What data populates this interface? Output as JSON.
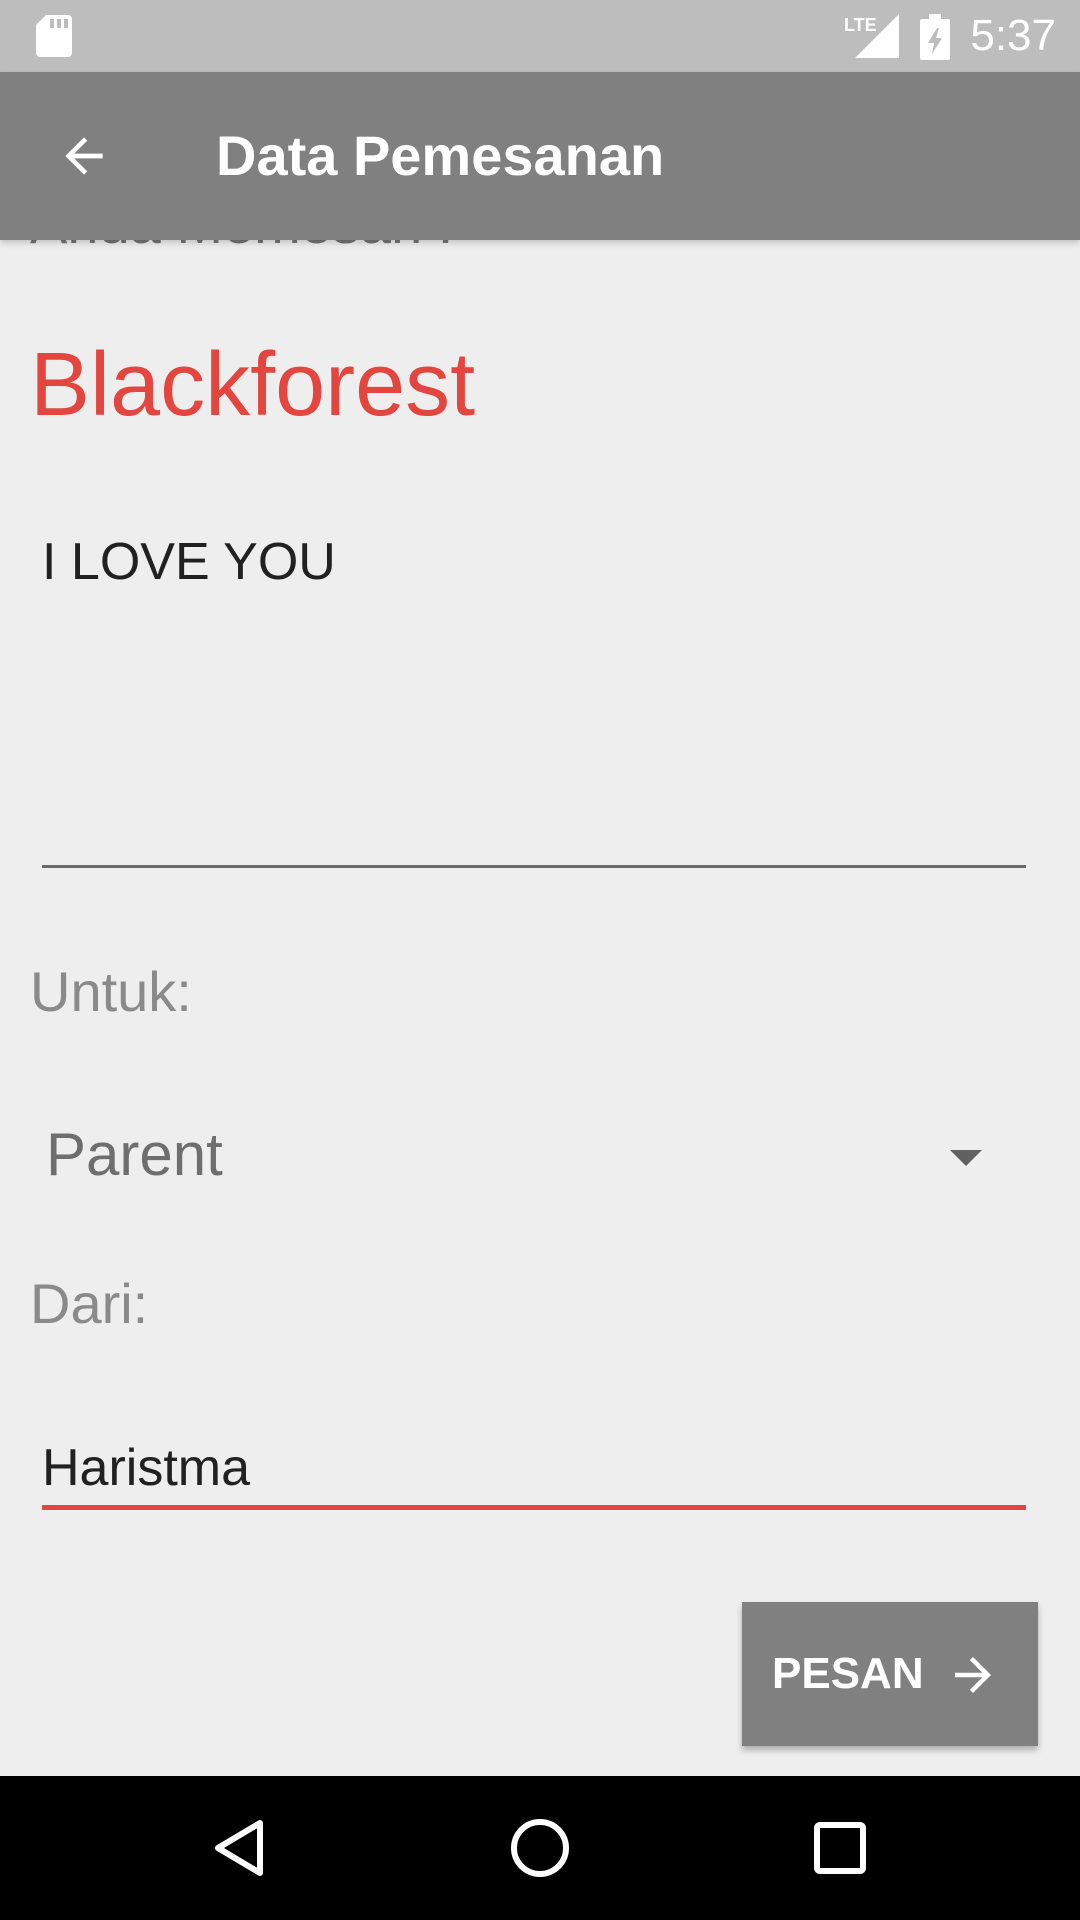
{
  "status_bar": {
    "time": "5:37",
    "network_label": "LTE",
    "icons": [
      "sd-card-icon",
      "lte-signal-icon",
      "battery-charging-icon"
    ]
  },
  "app_bar": {
    "title": "Data Pemesanan",
    "back_icon": "arrow-back-icon"
  },
  "form": {
    "order_label": "Anda Memesan :",
    "product_name": "Blackforest",
    "message_value": "I LOVE YOU",
    "to_label": "Untuk:",
    "to_selected": "Parent",
    "from_label": "Dari:",
    "from_value": "Haristma"
  },
  "action": {
    "submit_label": "PESAN",
    "submit_icon": "arrow-forward-icon"
  },
  "nav_bar": {
    "icons": [
      "back-triangle-icon",
      "home-circle-icon",
      "recents-square-icon"
    ]
  },
  "colors": {
    "accent": "#e2463f",
    "app_bar": "#808080",
    "status_bar": "#bdbdbd",
    "background": "#eeeeee"
  }
}
